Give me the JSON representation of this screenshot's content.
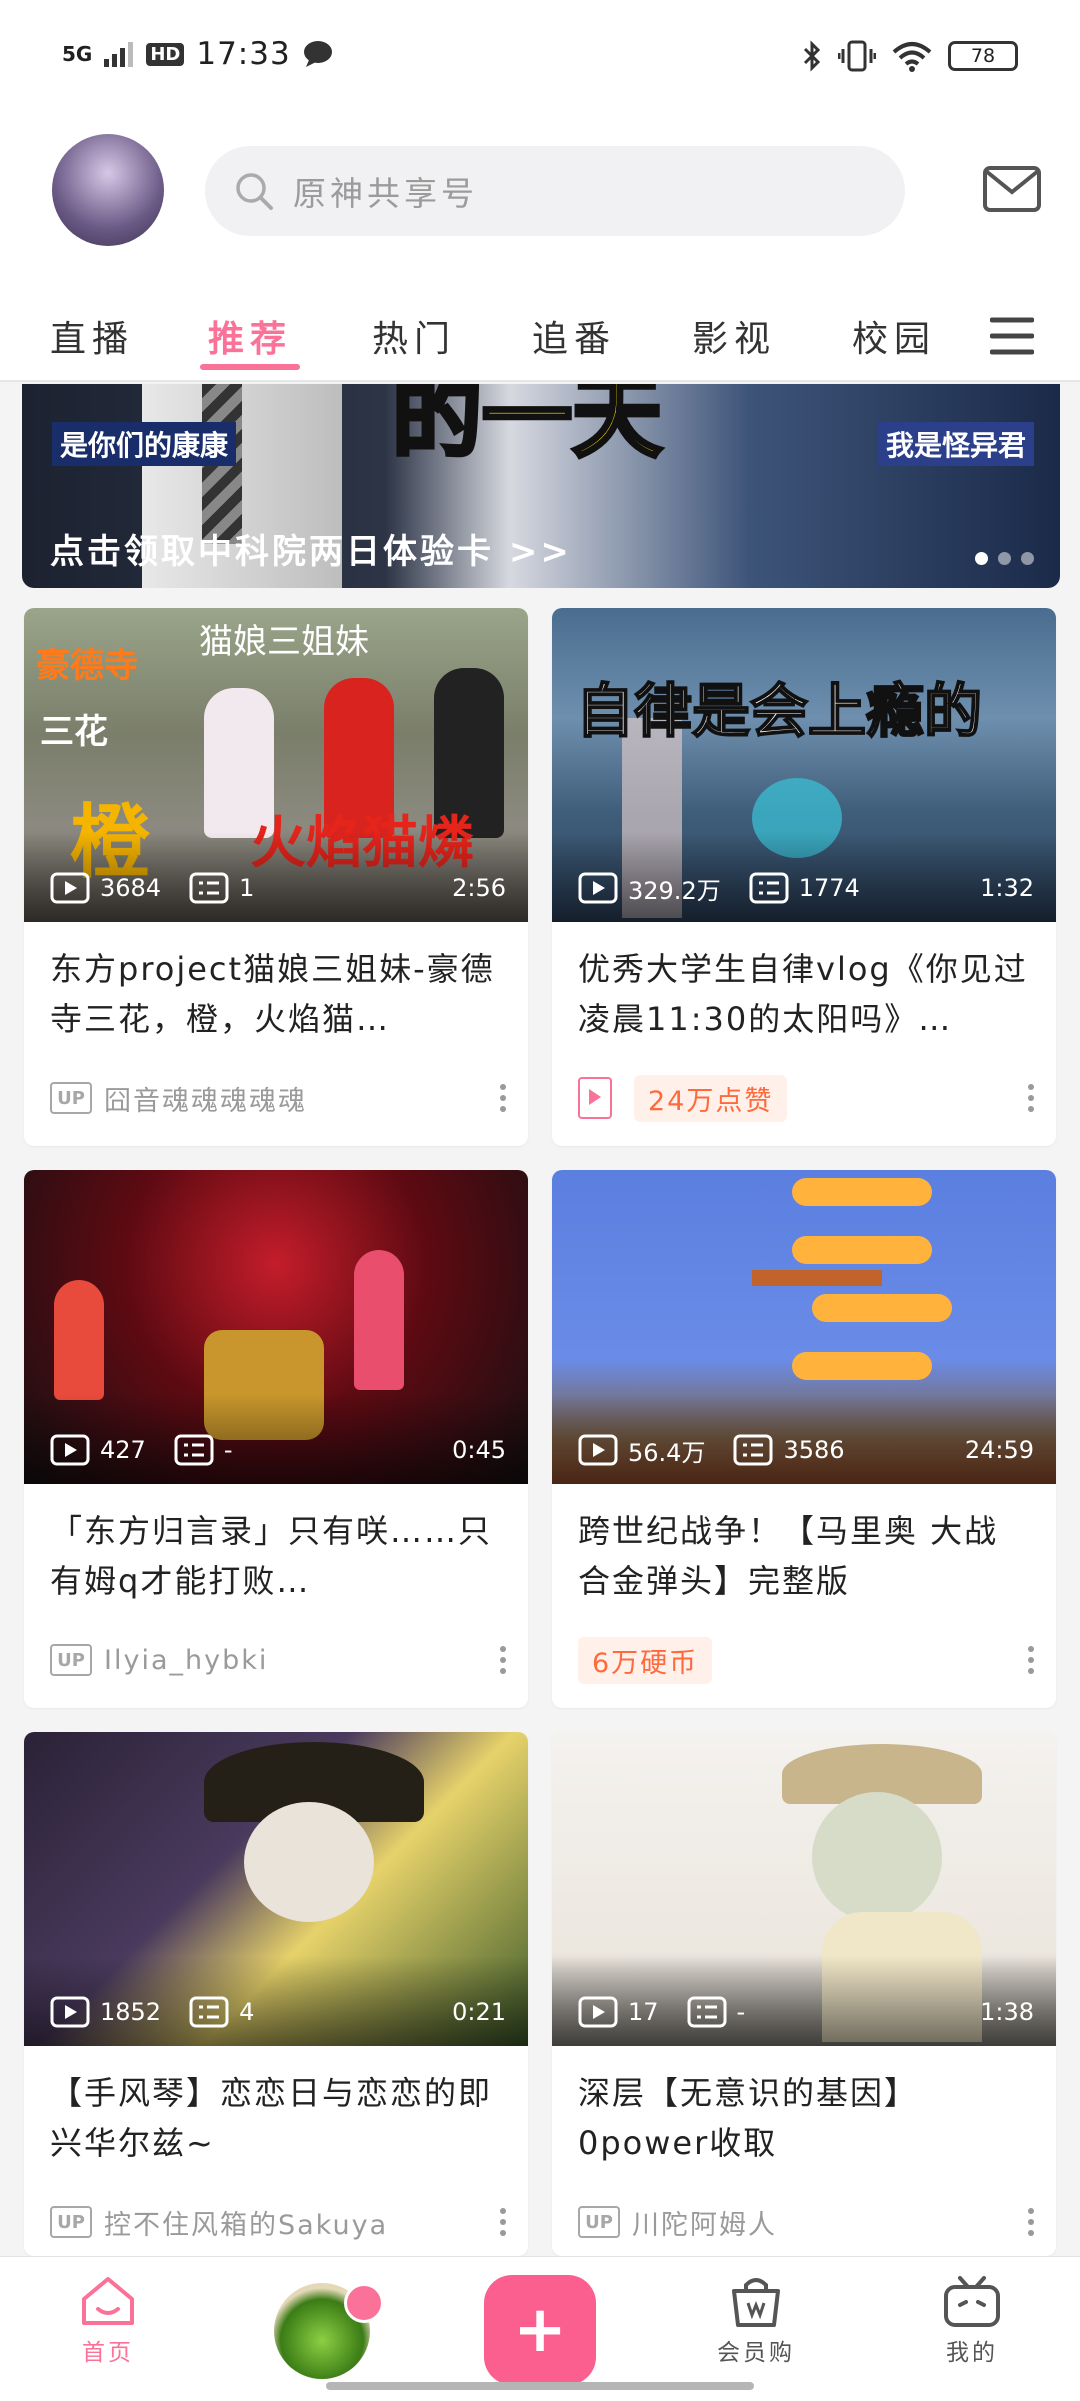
{
  "status_bar": {
    "network": "5G",
    "hd": "HD",
    "time": "17:33",
    "battery": "78"
  },
  "header": {
    "search_placeholder": "原神共享号",
    "tabs": [
      "直播",
      "推荐",
      "热门",
      "追番",
      "影视",
      "校园"
    ],
    "active_tab": "推荐"
  },
  "banner": {
    "tag_left": "是你们的康康",
    "tag_right": "我是怪异君",
    "headline": "的一天",
    "caption": "点击领取中科院两日体验卡 >>"
  },
  "feed": [
    {
      "views": "3684",
      "danmaku": "1",
      "duration": "2:56",
      "title": "东方project猫娘三姐妹-豪德寺三花，橙，火焰猫…",
      "up_name": "囧音魂魂魂魂魂",
      "thumb_overlay": [
        "猫娘三姐妹",
        "豪德寺",
        "三花",
        "橙",
        "火焰猫燐"
      ]
    },
    {
      "views": "329.2万",
      "danmaku": "1774",
      "duration": "1:32",
      "title": "优秀大学生自律vlog《你见过凌晨11:30的太阳吗》…",
      "badge": "24万点赞",
      "thumb_overlay": [
        "自律是会上瘾的"
      ]
    },
    {
      "views": "427",
      "danmaku": "-",
      "duration": "0:45",
      "title": "「东方归言录」只有咲……只有姆q才能打败…",
      "up_name": "Ilyia_hybki"
    },
    {
      "views": "56.4万",
      "danmaku": "3586",
      "duration": "24:59",
      "title": "跨世纪战争！【马里奥 大战 合金弹头】完整版",
      "badge": "6万硬币"
    },
    {
      "views": "1852",
      "danmaku": "4",
      "duration": "0:21",
      "title": "【手风琴】恋恋日与恋恋的即兴华尔兹~",
      "up_name": "控不住风箱的Sakuya"
    },
    {
      "views": "17",
      "danmaku": "-",
      "duration": "1:38",
      "title": "深层【无意识的基因】0power收取",
      "up_name": "川陀阿姆人"
    }
  ],
  "bottom_nav": {
    "home": "首页",
    "vip": "会员购",
    "mine": "我的",
    "add": "+"
  },
  "colors": {
    "accent": "#fb7299",
    "badge_orange": "#ff6a3d"
  }
}
